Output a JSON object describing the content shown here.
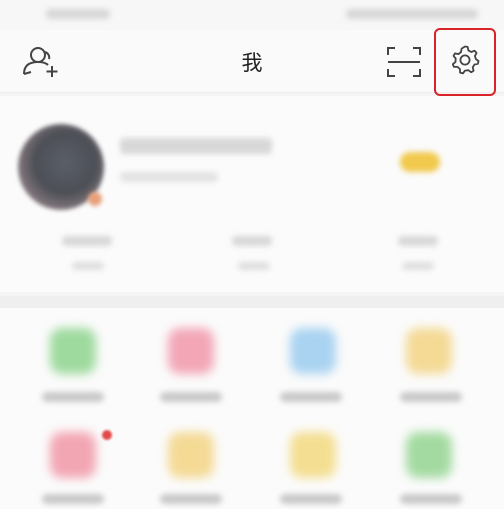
{
  "header": {
    "title": "我",
    "left_icon": "add-friend-icon",
    "right_icons": [
      "scan-icon",
      "gear-icon"
    ]
  },
  "annotation": {
    "color": "#d8232a",
    "target": "gear-icon"
  },
  "profile": {
    "avatar": "avatar"
  },
  "grid": {
    "items": [
      {
        "icon_color": "#7fcf7f"
      },
      {
        "icon_color": "#f08aa0"
      },
      {
        "icon_color": "#8ec6ee"
      },
      {
        "icon_color": "#f2cf74"
      },
      {
        "icon_color": "#f0899b"
      },
      {
        "icon_color": "#f2cf74"
      },
      {
        "icon_color": "#f2d56e"
      },
      {
        "icon_color": "#86d083"
      }
    ]
  },
  "colors": {
    "background": "#f4f4f4",
    "annotation": "#d8232a",
    "icon_stroke": "#444444"
  }
}
